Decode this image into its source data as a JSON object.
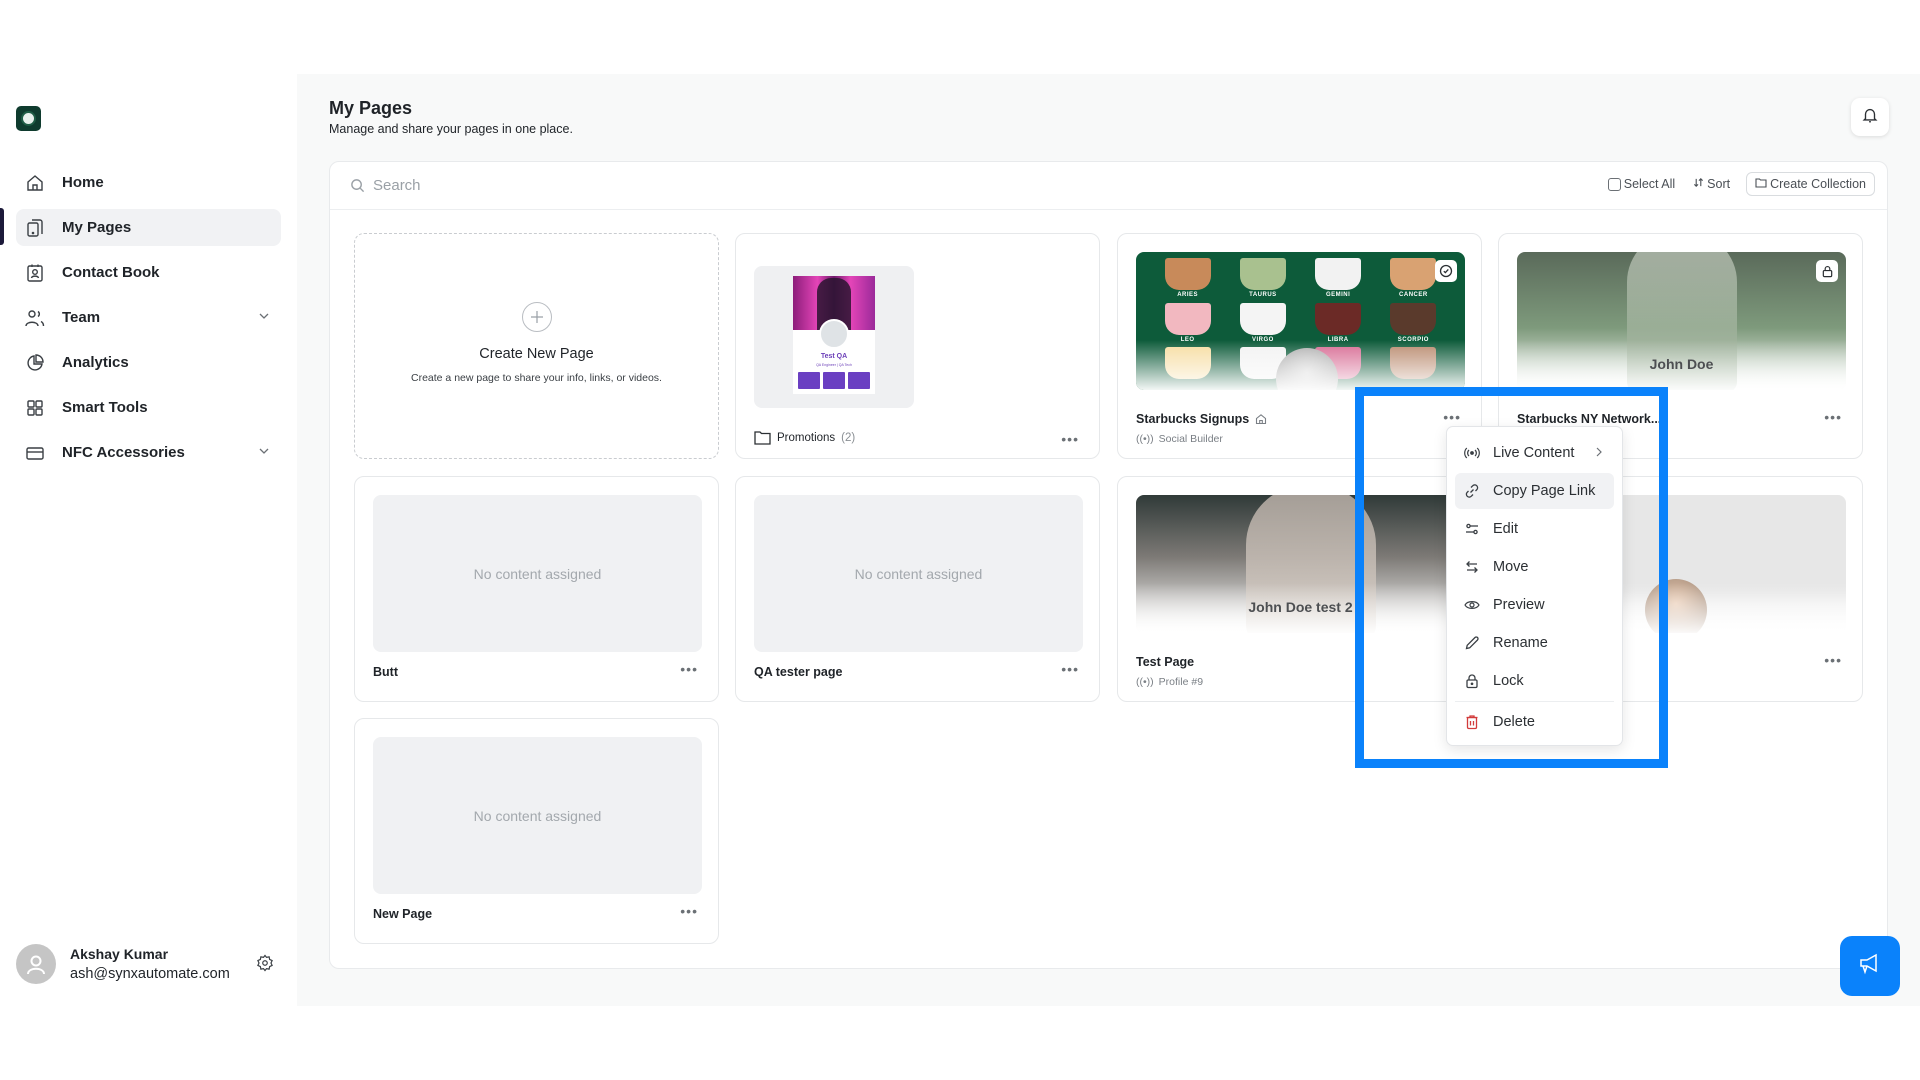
{
  "sidebar": {
    "logo_icon": "starbucks-logo",
    "items": [
      {
        "label": "Home",
        "icon": "home-icon"
      },
      {
        "label": "My Pages",
        "icon": "pages-icon",
        "active": true
      },
      {
        "label": "Contact Book",
        "icon": "contact-book-icon"
      },
      {
        "label": "Team",
        "icon": "team-icon",
        "expandable": true
      },
      {
        "label": "Analytics",
        "icon": "pie-chart-icon"
      },
      {
        "label": "Smart Tools",
        "icon": "grid-icon"
      },
      {
        "label": "NFC Accessories",
        "icon": "card-icon",
        "expandable": true
      }
    ],
    "user": {
      "name": "Akshay Kumar",
      "email": "ash@synxautomate.com",
      "settings_icon": "gear-icon"
    }
  },
  "header": {
    "title": "My Pages",
    "subtitle": "Manage and share your pages in one place.",
    "notification_icon": "bell-icon"
  },
  "toolbar": {
    "search_placeholder": "Search",
    "select_all": "Select All",
    "sort": "Sort",
    "create_collection": "Create Collection"
  },
  "create_card": {
    "title": "Create New Page",
    "description": "Create a new page to share your info, links, or videos."
  },
  "folder": {
    "name": "Promotions",
    "count": "(2)",
    "preview": {
      "name": "Test QA",
      "role": "QA Engineer | QA Tech"
    }
  },
  "pages": [
    {
      "name": "Starbucks Signups",
      "subtitle": "Social Builder",
      "home": true,
      "badge": "check-circle-icon"
    },
    {
      "name": "Starbucks NY Network...",
      "overlay": "John Doe",
      "badge": "lock-icon"
    },
    {
      "name": "Butt",
      "empty_text": "No content assigned"
    },
    {
      "name": "QA tester page",
      "empty_text": "No content assigned"
    },
    {
      "name": "Test Page",
      "subtitle": "Profile #9",
      "overlay": "John Doe test 2"
    },
    {
      "name": "",
      "overlay": ""
    },
    {
      "name": "New Page",
      "empty_text": "No content assigned"
    }
  ],
  "starbucks_labels": [
    "ARIES",
    "TAURUS",
    "GEMINI",
    "CANCER",
    "LEO",
    "VIRGO",
    "LIBRA",
    "SCORPIO"
  ],
  "context_menu": {
    "items": [
      {
        "label": "Live Content",
        "icon": "broadcast-icon",
        "submenu": true
      },
      {
        "label": "Copy Page Link",
        "icon": "link-icon",
        "hover": true
      },
      {
        "label": "Edit",
        "icon": "sliders-icon"
      },
      {
        "label": "Move",
        "icon": "arrows-swap-icon"
      },
      {
        "label": "Preview",
        "icon": "eye-icon"
      },
      {
        "label": "Rename",
        "icon": "pencil-icon"
      },
      {
        "label": "Lock",
        "icon": "lock-icon"
      },
      {
        "label": "Delete",
        "icon": "trash-icon",
        "danger": true
      }
    ]
  },
  "colors": {
    "highlight": "#0a82fb",
    "accent_fab": "#0a82fb",
    "danger": "#d23b3b",
    "brand_green": "#0f3b2e"
  }
}
